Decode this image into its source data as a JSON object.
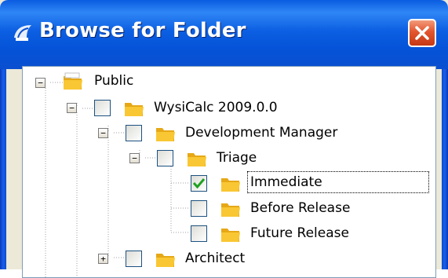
{
  "window": {
    "title": "Browse for Folder",
    "close_icon": "close-icon",
    "title_icon": "tree-shell-icon"
  },
  "colors": {
    "titlebar": "#0c5fe2",
    "close": "#e2552e",
    "folder": "#f9c733",
    "check": "#21a121"
  },
  "tree": {
    "public": {
      "label": "Public",
      "expanded": true
    },
    "wysicalc": {
      "label": "WysiCalc 2009.0.0",
      "checked": false,
      "expanded": true
    },
    "devmgr": {
      "label": "Development Manager",
      "checked": false,
      "expanded": true
    },
    "triage": {
      "label": "Triage",
      "checked": false,
      "expanded": true
    },
    "immediate": {
      "label": "Immediate",
      "checked": true,
      "focused": true
    },
    "before_release": {
      "label": "Before Release",
      "checked": false
    },
    "future_release": {
      "label": "Future Release",
      "checked": false
    },
    "architect": {
      "label": "Architect",
      "checked": false,
      "expanded": false
    }
  },
  "expander_symbols": {
    "expanded": "−",
    "collapsed": "+"
  }
}
